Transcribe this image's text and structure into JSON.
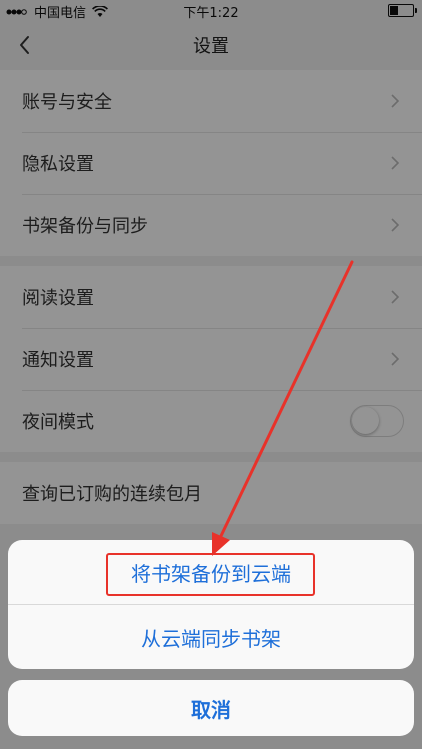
{
  "status_bar": {
    "carrier": "中国电信",
    "time": "下午1:22",
    "battery_level": 0.4
  },
  "nav": {
    "title": "设置",
    "back_icon": "chevron-left-icon"
  },
  "groups": [
    {
      "items": [
        {
          "label": "账号与安全"
        },
        {
          "label": "隐私设置"
        },
        {
          "label": "书架备份与同步"
        }
      ]
    },
    {
      "items": [
        {
          "label": "阅读设置"
        },
        {
          "label": "通知设置"
        },
        {
          "label": "夜间模式",
          "toggle": false
        }
      ]
    },
    {
      "items": [
        {
          "label": "查询已订购的连续包月"
        }
      ]
    }
  ],
  "action_sheet": {
    "options": [
      {
        "label": "将书架备份到云端"
      },
      {
        "label": "从云端同步书架"
      }
    ],
    "cancel_label": "取消"
  },
  "colors": {
    "accent": "#1e6fd9",
    "annotation": "#e8322a"
  }
}
